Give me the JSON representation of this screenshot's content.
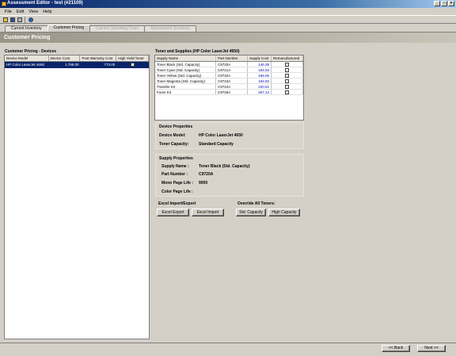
{
  "window": {
    "title": "Assessment Editor - test (#21109)"
  },
  "menu": [
    "File",
    "Edit",
    "View",
    "Help"
  ],
  "tabs": [
    {
      "label": "Current Inventory",
      "state": "normal"
    },
    {
      "label": "Customer Pricing",
      "state": "active"
    },
    {
      "label": "Current Operating Costs",
      "state": "disabled"
    },
    {
      "label": "Assessment Summary",
      "state": "disabled"
    }
  ],
  "header": {
    "title": "Customer Pricing"
  },
  "devices": {
    "label": "Customer Pricing - Devices",
    "columns": [
      "Device Model",
      "Device Cost",
      "Post Warranty Cost",
      "High Yield Toner"
    ],
    "rows": [
      {
        "model": "HP Color LaserJet 4650",
        "cost": "1,799.00",
        "post_warranty": "773.00"
      }
    ]
  },
  "supplies": {
    "label": "Toner and Supplies (HP Color LaserJet 4650)",
    "columns": [
      "Supply Name",
      "Part Number",
      "Supply Cost",
      "Remanufactured"
    ],
    "rows": [
      {
        "name": "Toner Black (Std. Capacity)",
        "part": "C9720A",
        "cost": "146.39"
      },
      {
        "name": "Toner Cyan (Std. Capacity)",
        "part": "C9721A",
        "cost": "194.03"
      },
      {
        "name": "Toner Yellow (Std. Capacity)",
        "part": "C9722A",
        "cost": "195.05"
      },
      {
        "name": "Toner Magenta (Std. Capacity)",
        "part": "C9723A",
        "cost": "194.92"
      },
      {
        "name": "Transfer Kit",
        "part": "C9724A",
        "cost": "220.51"
      },
      {
        "name": "Fuser Kit",
        "part": "C9725A",
        "cost": "267.13"
      }
    ]
  },
  "device_properties": {
    "title": "Device Properties",
    "model_label": "Device Model:",
    "model_value": "HP Color LaserJet 4650",
    "capacity_label": "Toner Capacity:",
    "capacity_value": "Standard Capacity"
  },
  "supply_properties": {
    "title": "Supply Properties",
    "name_label": "Supply Name :",
    "name_value": "Toner Black (Std. Capacity)",
    "part_label": "Part Number :",
    "part_value": "C9720A",
    "mono_label": "Mono Page Life :",
    "mono_value": "9000",
    "color_label": "Color Page Life :",
    "color_value": ""
  },
  "excel": {
    "title": "Excel Import/Export",
    "export_label": "Excel Export",
    "import_label": "Excel Import"
  },
  "override": {
    "title": "Override All Toners:",
    "std_label": "Std. Capacity",
    "high_label": "High Capacity"
  },
  "footer": {
    "back_label": "<< Back",
    "next_label": "Next >>"
  }
}
